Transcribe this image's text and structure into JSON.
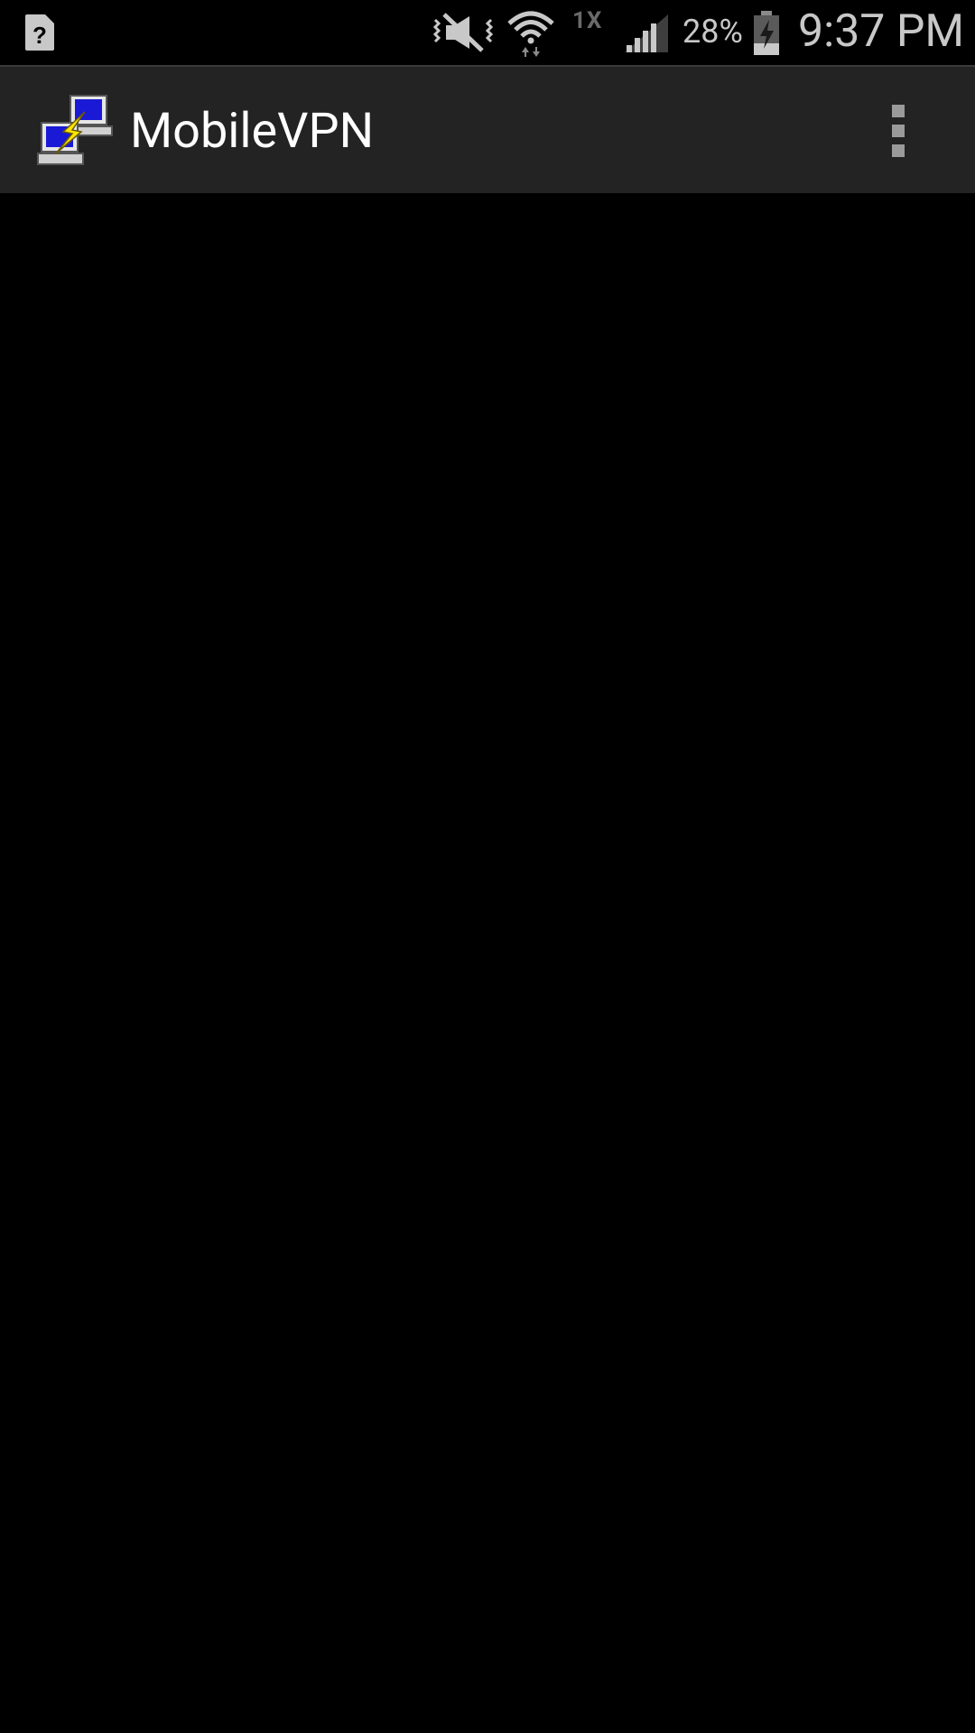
{
  "status_bar": {
    "network_type": "1X",
    "battery_percent": "28%",
    "time": "9:37 PM",
    "icons": [
      "sim-unknown-icon",
      "mute-vibrate-icon",
      "wifi-icon",
      "signal-icon",
      "battery-charging-icon"
    ]
  },
  "action_bar": {
    "title": "MobileVPN",
    "app_icon": "networked-computers-icon",
    "overflow_icon": "overflow-menu-icon"
  },
  "colors": {
    "background": "#000000",
    "action_bar": "#232323",
    "title_text": "#ffffff",
    "status_text": "#c8c8c8"
  }
}
